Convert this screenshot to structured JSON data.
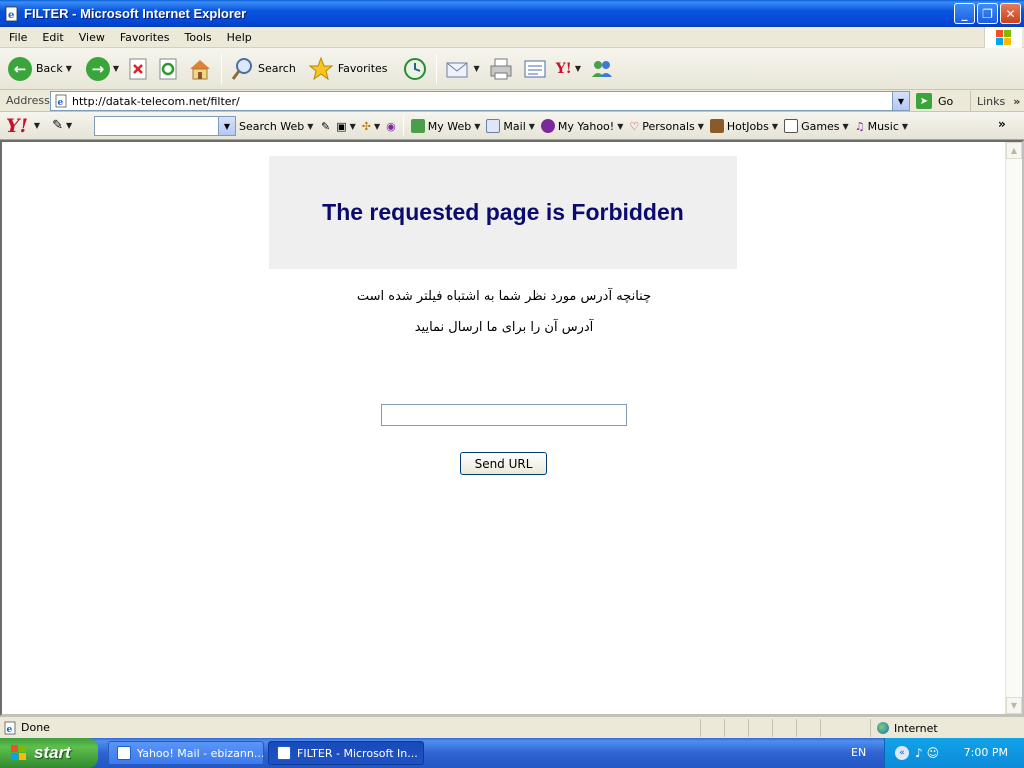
{
  "window": {
    "title": "FILTER - Microsoft Internet Explorer",
    "minimize_label": "_",
    "maximize_label": "❐",
    "close_label": "✕"
  },
  "menu": {
    "items": [
      "File",
      "Edit",
      "View",
      "Favorites",
      "Tools",
      "Help"
    ]
  },
  "toolbar": {
    "back_label": "Back",
    "search_label": "Search",
    "favorites_label": "Favorites"
  },
  "address_bar": {
    "label": "Address",
    "url": "http://datak-telecom.net/filter/",
    "go_label": "Go",
    "links_label": "Links"
  },
  "yahoo_toolbar": {
    "logo": "Y!",
    "search_web_label": "Search Web",
    "search_value": "",
    "items": [
      "My Web",
      "Mail",
      "My Yahoo!",
      "Personals",
      "HotJobs",
      "Games",
      "Music"
    ]
  },
  "page": {
    "heading": "The requested page is Forbidden",
    "message_line1": "چنانچه آدرس مورد نظر شما به اشتباه فیلتر شده است",
    "message_line2": "آدرس آن را برای ما ارسال نمایید",
    "url_input_value": "",
    "send_button_label": "Send URL"
  },
  "status_bar": {
    "status_text": "Done",
    "zone_text": "Internet"
  },
  "taskbar": {
    "start_label": "start",
    "tasks": [
      {
        "label": "Yahoo! Mail - ebizann...",
        "active": false
      },
      {
        "label": "FILTER - Microsoft In...",
        "active": true
      }
    ],
    "language": "EN",
    "clock": "7:00 PM"
  },
  "colors": {
    "heading_color": "#0b0b6e",
    "titlebar_blue": "#0855dd",
    "start_green": "#3d9e3d"
  }
}
